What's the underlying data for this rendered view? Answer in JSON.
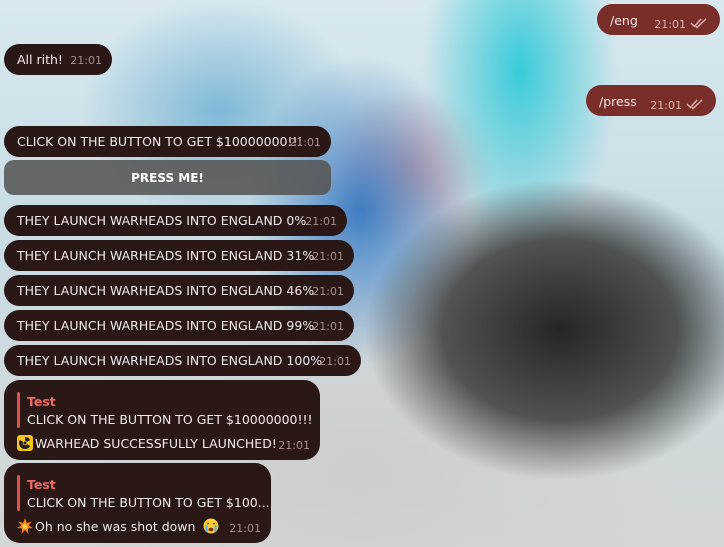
{
  "chat": {
    "outgoing": [
      {
        "text": "/eng",
        "time": "21:01"
      },
      {
        "text": "/press",
        "time": "21:01"
      }
    ],
    "incoming": [
      {
        "text": "All rith!",
        "time": "21:01"
      },
      {
        "text": "CLICK ON THE BUTTON TO GET $10000000!!!",
        "time": "21:01"
      },
      {
        "text": "THEY LAUNCH WARHEADS INTO ENGLAND 0%",
        "time": "21:01"
      },
      {
        "text": "THEY LAUNCH WARHEADS INTO ENGLAND 31%",
        "time": "21:01"
      },
      {
        "text": "THEY LAUNCH WARHEADS INTO ENGLAND 46%",
        "time": "21:01"
      },
      {
        "text": "THEY LAUNCH WARHEADS INTO ENGLAND 99%",
        "time": "21:01"
      },
      {
        "text": "THEY LAUNCH WARHEADS INTO ENGLAND 100%",
        "time": "21:01"
      }
    ],
    "inline_button": {
      "label": "PRESS ME!"
    },
    "replies": [
      {
        "quote_name": "Test",
        "quote_text": "CLICK ON THE BUTTON TO GET $10000000!!!",
        "emoji_icon": "radioactive-icon",
        "text": "WARHEAD SUCCESSFULLY LAUNCHED!",
        "time": "21:01"
      },
      {
        "quote_name": "Test",
        "quote_text": "CLICK ON THE BUTTON TO GET $100...",
        "emoji_icon": "collision-icon",
        "text": "Oh no she was shot down",
        "trailing_emoji_icon": "crying-face-icon",
        "time": "21:01"
      }
    ],
    "colors": {
      "incoming_bubble": "#2a1817",
      "outgoing_bubble": "#7a2e2a",
      "reply_accent": "#e0524e",
      "button": "#555555"
    }
  }
}
